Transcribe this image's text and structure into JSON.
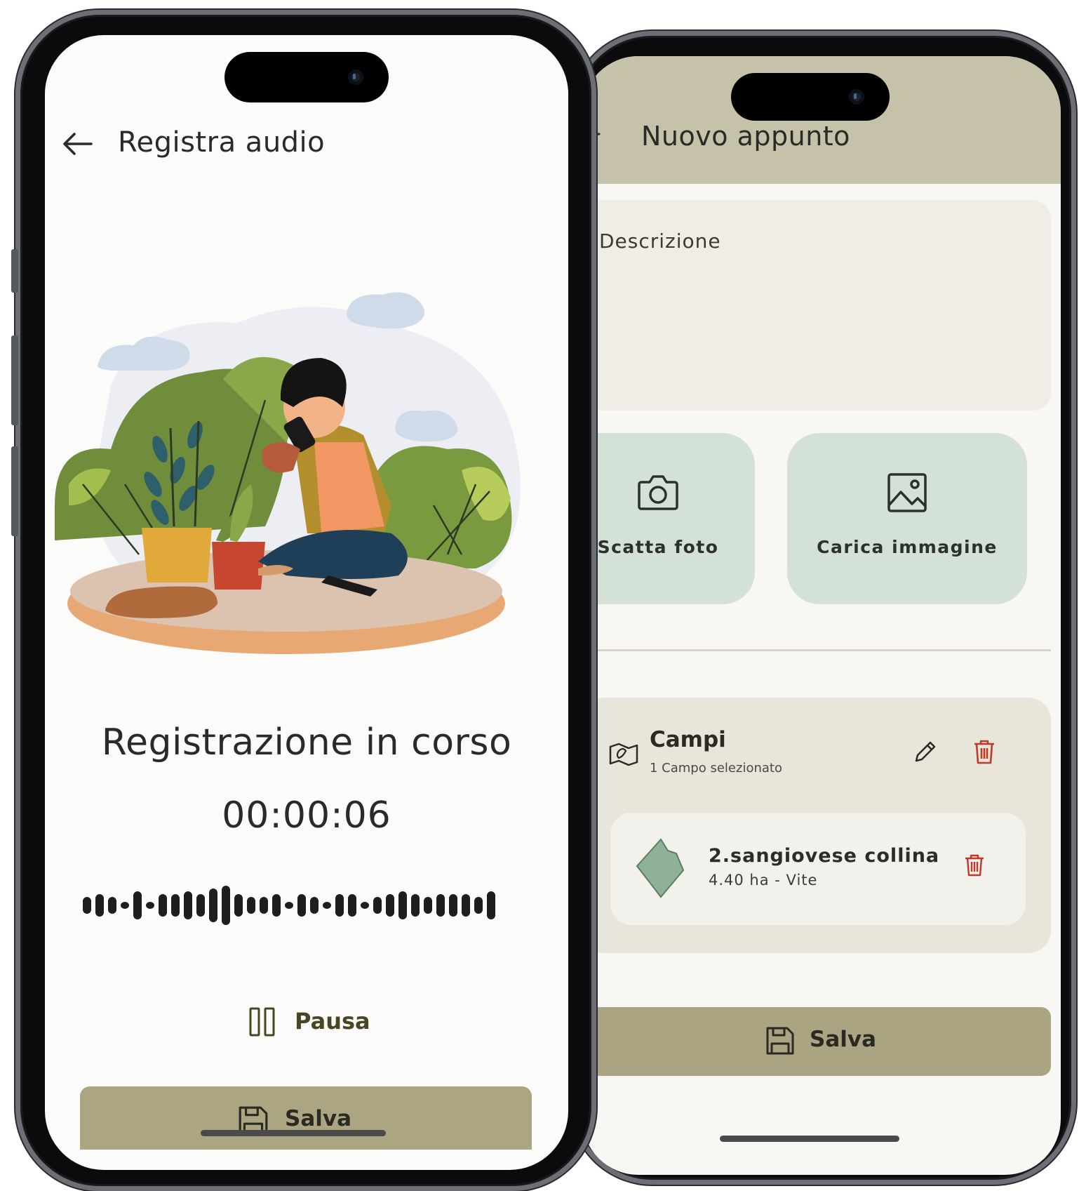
{
  "back_screen": {
    "header": {
      "title": "Nuovo appunto"
    },
    "description": {
      "label": "Descrizione"
    },
    "media_buttons": [
      {
        "label": "Scatta foto",
        "icon": "camera-icon"
      },
      {
        "label": "Carica immagine",
        "icon": "image-icon"
      }
    ],
    "fields": {
      "title": "Campi",
      "subtitle": "1 Campo selezionato",
      "items": [
        {
          "name": "2.sangiovese collina",
          "meta": "4.40 ha - Vite"
        }
      ]
    },
    "save_label": "Salva"
  },
  "front_screen": {
    "header": {
      "title": "Registra audio"
    },
    "status": "Registrazione in corso",
    "timer": "00:00:06",
    "pause_label": "Pausa",
    "save_label": "Salva"
  },
  "colors": {
    "header_back": "#c5c2a9",
    "media_button": "#d3e1d7",
    "save_button": "#aaa483",
    "delete_red": "#c0392b",
    "field_shape": "#8fb195"
  }
}
